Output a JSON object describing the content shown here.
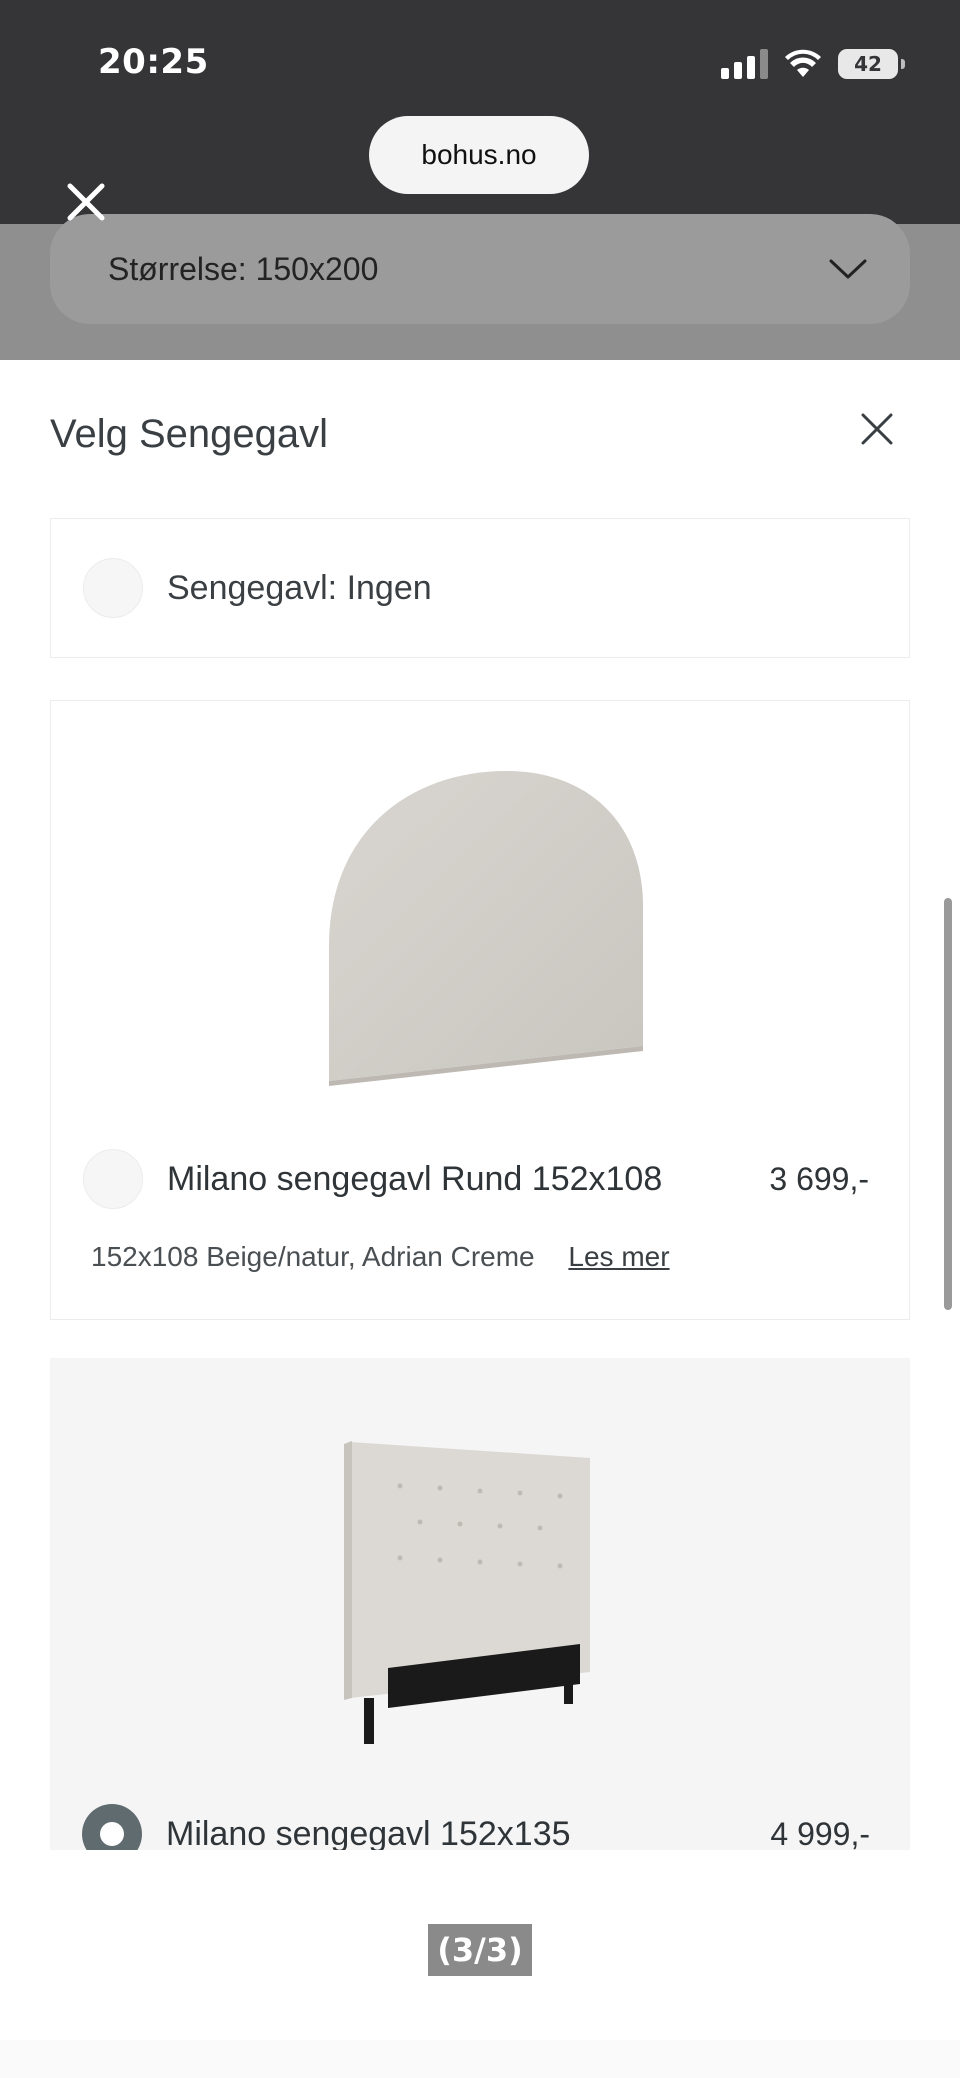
{
  "status_bar": {
    "time": "20:25",
    "battery": "42"
  },
  "browser": {
    "url": "bohus.no"
  },
  "size_select": {
    "label": "Størrelse: 150x200"
  },
  "sheet": {
    "title": "Velg Sengegavl",
    "none_option": {
      "label": "Sengegavl: Ingen"
    },
    "products": [
      {
        "name": "Milano sengegavl Rund 152x108",
        "price": "3 699,-",
        "description": "152x108 Beige/natur, Adrian Creme",
        "read_more": "Les mer",
        "selected": false
      },
      {
        "name": "Milano sengegavl 152x135",
        "price": "4 999,-",
        "selected": true
      }
    ]
  },
  "caption": "(3/3)",
  "colors": {
    "chrome": "#353538",
    "radio_selected": "#5f6b6e",
    "card_alt_bg": "#f5f5f5"
  }
}
